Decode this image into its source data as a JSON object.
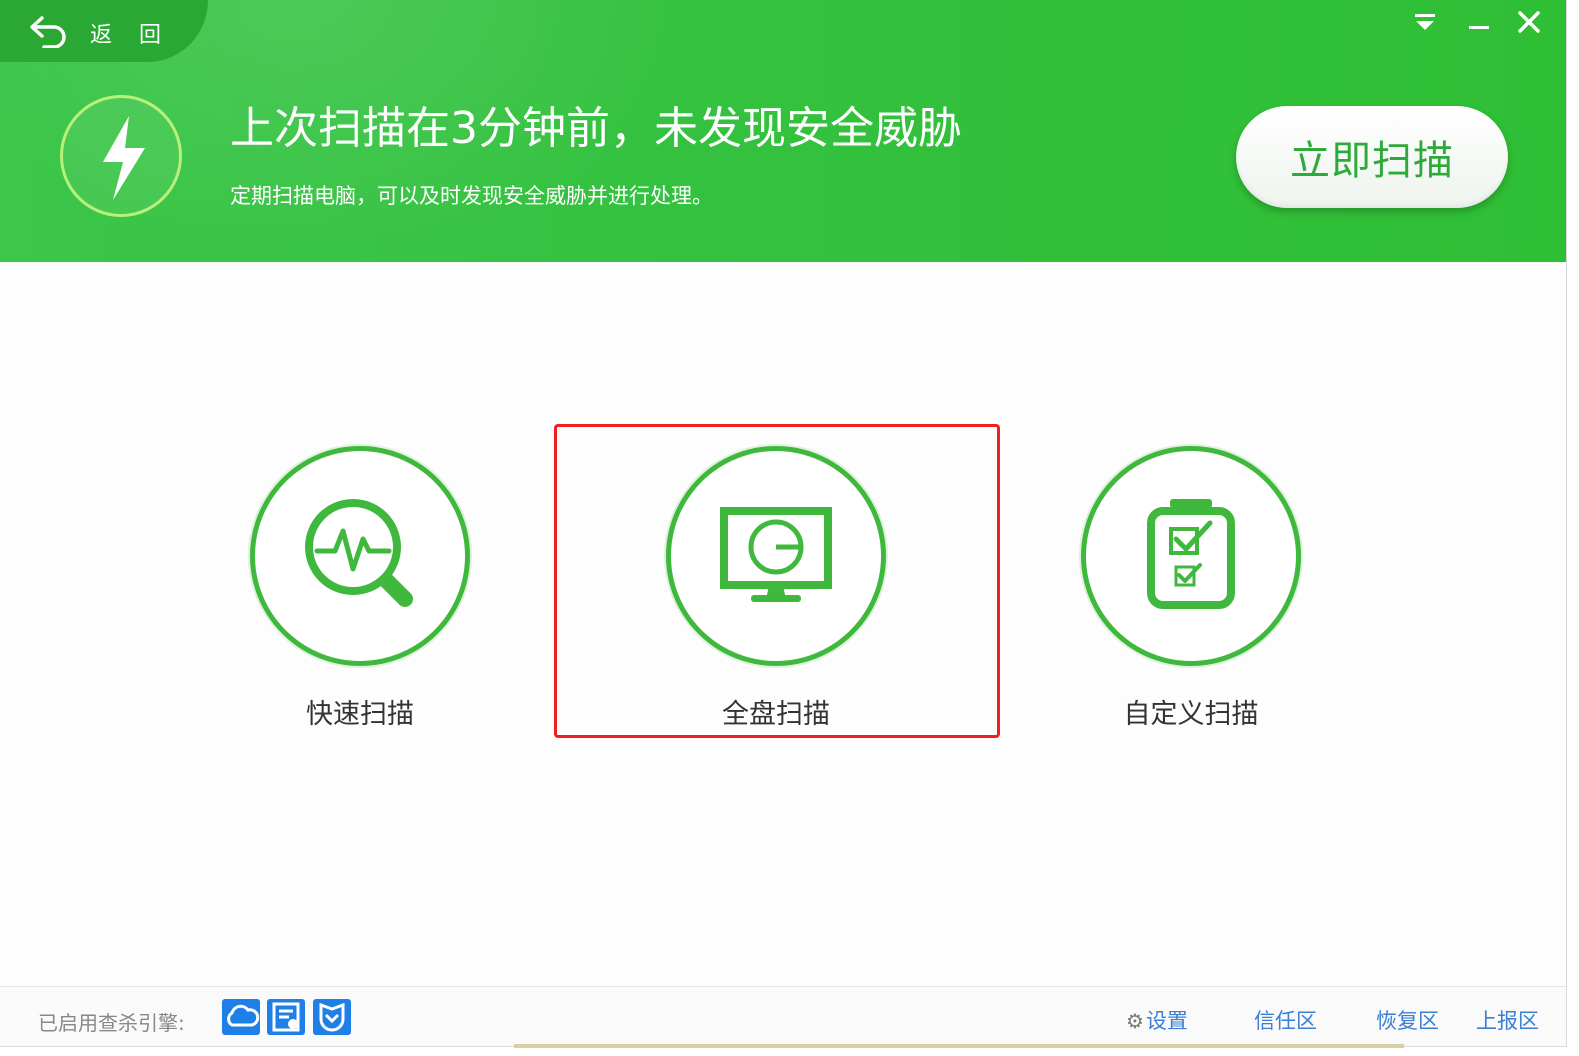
{
  "header": {
    "back_label": "返 回",
    "headline": "上次扫描在3分钟前，未发现安全威胁",
    "subline": "定期扫描电脑，可以及时发现安全威胁并进行处理。",
    "scan_now_label": "立即扫描"
  },
  "window_controls": {
    "menu_icon": "dropdown-menu-icon",
    "minimize_icon": "minimize-icon",
    "close_icon": "close-icon"
  },
  "scan_options": [
    {
      "label": "快速扫描",
      "icon": "pulse-magnifier-icon"
    },
    {
      "label": "全盘扫描",
      "icon": "monitor-scan-icon"
    },
    {
      "label": "自定义扫描",
      "icon": "checklist-icon"
    }
  ],
  "footer": {
    "engines_label": "已启用查杀引擎:",
    "engines": [
      "cloud-engine-icon",
      "document-engine-icon",
      "shield-engine-icon"
    ],
    "links": {
      "settings": "设置",
      "trust_zone": "信任区",
      "restore_zone": "恢复区",
      "report_zone": "上报区"
    }
  },
  "colors": {
    "header_green": "#34c13f",
    "accent_green": "#3fb83d",
    "link_blue": "#3b7fd4",
    "highlight_red": "#f02020"
  }
}
